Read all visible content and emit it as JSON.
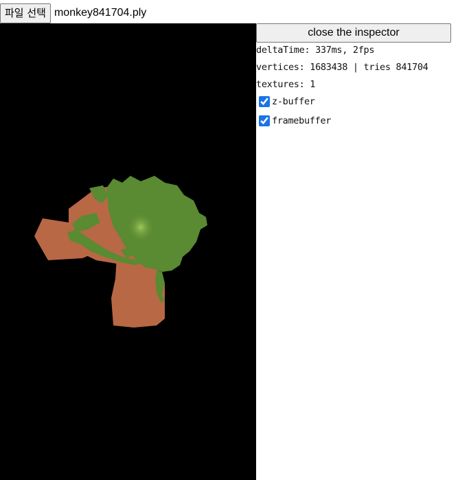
{
  "file_input": {
    "button_label": "파일 선택",
    "file_name": "monkey841704.ply"
  },
  "inspector": {
    "close_label": "close the inspector",
    "delta_time": "deltaTime: 337ms, 2fps",
    "vertices": "vertices: 1683438 | tries 841704",
    "textures": "textures: 1",
    "z_buffer_label": "z-buffer",
    "z_buffer_checked": true,
    "framebuffer_label": "framebuffer",
    "framebuffer_checked": true
  },
  "render": {
    "background": "#000000",
    "mesh_color": "#b86845",
    "foliage_color": "#5a8a32",
    "foliage_highlight": "#8dbb4a"
  }
}
